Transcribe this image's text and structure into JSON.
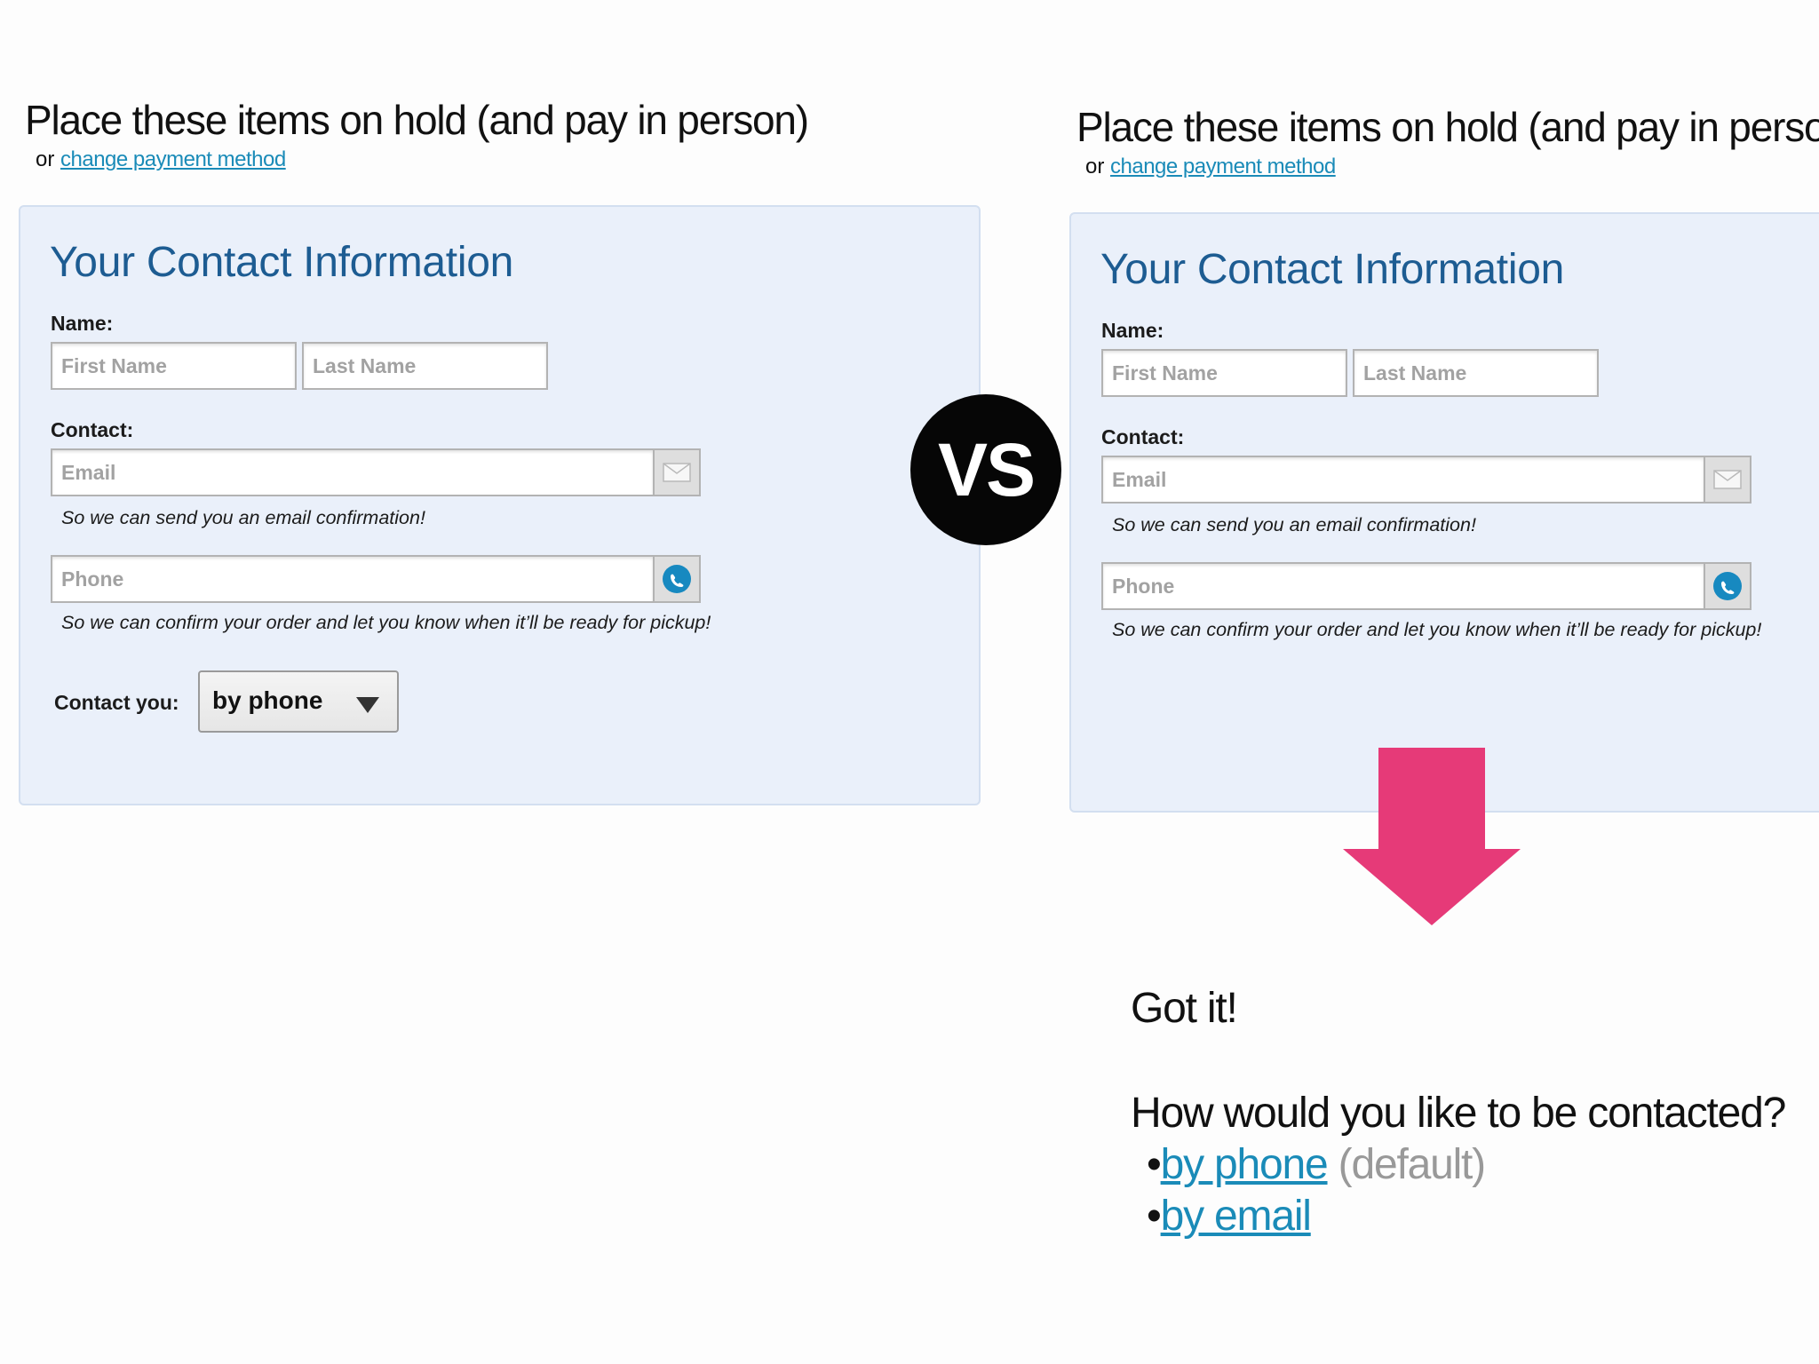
{
  "left": {
    "heading": "Place these items on hold (and pay in person)",
    "or_text": "or",
    "change_link": "change payment method",
    "panel_title": "Your Contact Information",
    "name_label": "Name:",
    "first_name_placeholder": "First Name",
    "last_name_placeholder": "Last Name",
    "contact_label": "Contact:",
    "email_placeholder": "Email",
    "email_hint": "So we can send you an email confirmation!",
    "phone_placeholder": "Phone",
    "phone_hint": "So we can confirm your order and let you know when it’ll be ready for pickup!",
    "contact_you_label": "Contact you:",
    "contact_you_value": "by phone"
  },
  "right": {
    "heading": "Place these items on hold (and pay in person)",
    "or_text": "or",
    "change_link": "change payment method",
    "panel_title": "Your Contact Information",
    "name_label": "Name:",
    "first_name_placeholder": "First Name",
    "last_name_placeholder": "Last Name",
    "contact_label": "Contact:",
    "email_placeholder": "Email",
    "email_hint": "So we can send you an email confirmation!",
    "phone_placeholder": "Phone",
    "phone_hint": "So we can confirm your order and let you know when it’ll be ready for pickup!"
  },
  "vs_label": "VS",
  "arrow_color": "#e63a78",
  "annotation": {
    "got_it": "Got it!",
    "question": "How would you like to be contacted?",
    "options": [
      {
        "bullet": "•",
        "label": "by phone",
        "note": "(default)"
      },
      {
        "bullet": "•",
        "label": "by email",
        "note": ""
      }
    ]
  },
  "icons": {
    "email": "envelope-icon",
    "phone": "phone-icon",
    "select": "caret-down-icon"
  }
}
